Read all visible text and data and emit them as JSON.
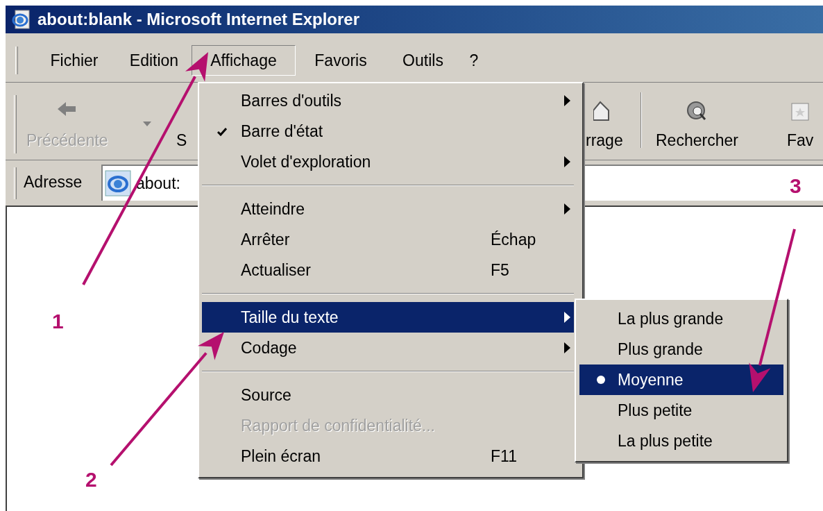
{
  "window": {
    "title": "about:blank - Microsoft Internet Explorer"
  },
  "menu_bar": [
    {
      "label": "Fichier",
      "selected": false
    },
    {
      "label": "Edition",
      "selected": false
    },
    {
      "label": "Affichage",
      "selected": true
    },
    {
      "label": "Favoris",
      "selected": false
    },
    {
      "label": "Outils",
      "selected": false
    },
    {
      "label": "?",
      "selected": false
    }
  ],
  "toolbar": [
    {
      "label": "Précédente",
      "kind": "back",
      "disabled": true
    },
    {
      "label": "S",
      "kind": "forward",
      "disabled": false
    },
    {
      "label": "rrage",
      "kind": "home",
      "disabled": false
    },
    {
      "label": "Rechercher",
      "kind": "search",
      "disabled": false
    },
    {
      "label": "Fav",
      "kind": "favorites",
      "disabled": false
    }
  ],
  "address": {
    "label": "Adresse",
    "value": "about:"
  },
  "view_menu": [
    {
      "kind": "item",
      "label": "Barres d'outils",
      "checked": false,
      "submenu": true,
      "highlighted": false,
      "disabled": false
    },
    {
      "kind": "item",
      "label": "Barre d'état",
      "checked": true,
      "submenu": false,
      "highlighted": false,
      "disabled": false
    },
    {
      "kind": "item",
      "label": "Volet d'exploration",
      "checked": false,
      "submenu": true,
      "highlighted": false,
      "disabled": false
    },
    {
      "kind": "separator"
    },
    {
      "kind": "item",
      "label": "Atteindre",
      "checked": false,
      "submenu": true,
      "highlighted": false,
      "disabled": false
    },
    {
      "kind": "item",
      "label": "Arrêter",
      "shortcut": "Échap",
      "checked": false,
      "submenu": false,
      "highlighted": false,
      "disabled": false
    },
    {
      "kind": "item",
      "label": "Actualiser",
      "shortcut": "F5",
      "checked": false,
      "submenu": false,
      "highlighted": false,
      "disabled": false
    },
    {
      "kind": "separator"
    },
    {
      "kind": "item",
      "label": "Taille du texte",
      "checked": false,
      "submenu": true,
      "highlighted": true,
      "disabled": false
    },
    {
      "kind": "item",
      "label": "Codage",
      "checked": false,
      "submenu": true,
      "highlighted": false,
      "disabled": false
    },
    {
      "kind": "separator"
    },
    {
      "kind": "item",
      "label": "Source",
      "checked": false,
      "submenu": false,
      "highlighted": false,
      "disabled": false
    },
    {
      "kind": "item",
      "label": "Rapport de confidentialité...",
      "checked": false,
      "submenu": false,
      "highlighted": false,
      "disabled": true
    },
    {
      "kind": "item",
      "label": "Plein écran",
      "shortcut": "F11",
      "checked": false,
      "submenu": false,
      "highlighted": false,
      "disabled": false
    }
  ],
  "text_size_menu": [
    {
      "label": "La plus grande",
      "selected": false,
      "highlighted": false
    },
    {
      "label": "Plus grande",
      "selected": false,
      "highlighted": false
    },
    {
      "label": "Moyenne",
      "selected": true,
      "highlighted": true
    },
    {
      "label": "Plus petite",
      "selected": false,
      "highlighted": false
    },
    {
      "label": "La plus petite",
      "selected": false,
      "highlighted": false
    }
  ],
  "annotations": [
    {
      "label": "1"
    },
    {
      "label": "2"
    },
    {
      "label": "3"
    }
  ]
}
